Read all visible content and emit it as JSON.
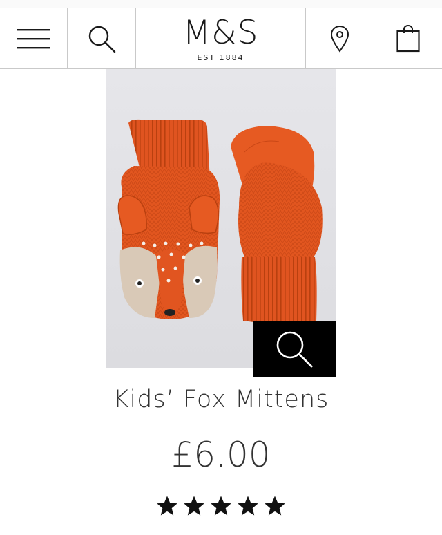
{
  "header": {
    "logo_main": "M&S",
    "logo_sub": "EST 1884",
    "icons": [
      "menu-icon",
      "search-icon",
      "store-locator-icon",
      "shopping-bag-icon"
    ]
  },
  "product": {
    "title": "Kids’ Fox Mittens",
    "price": "£6.00",
    "rating": 5,
    "rating_max": 5
  },
  "colors": {
    "accent_black": "#000000",
    "text": "#333333",
    "mitten_orange": "#e2561f"
  }
}
